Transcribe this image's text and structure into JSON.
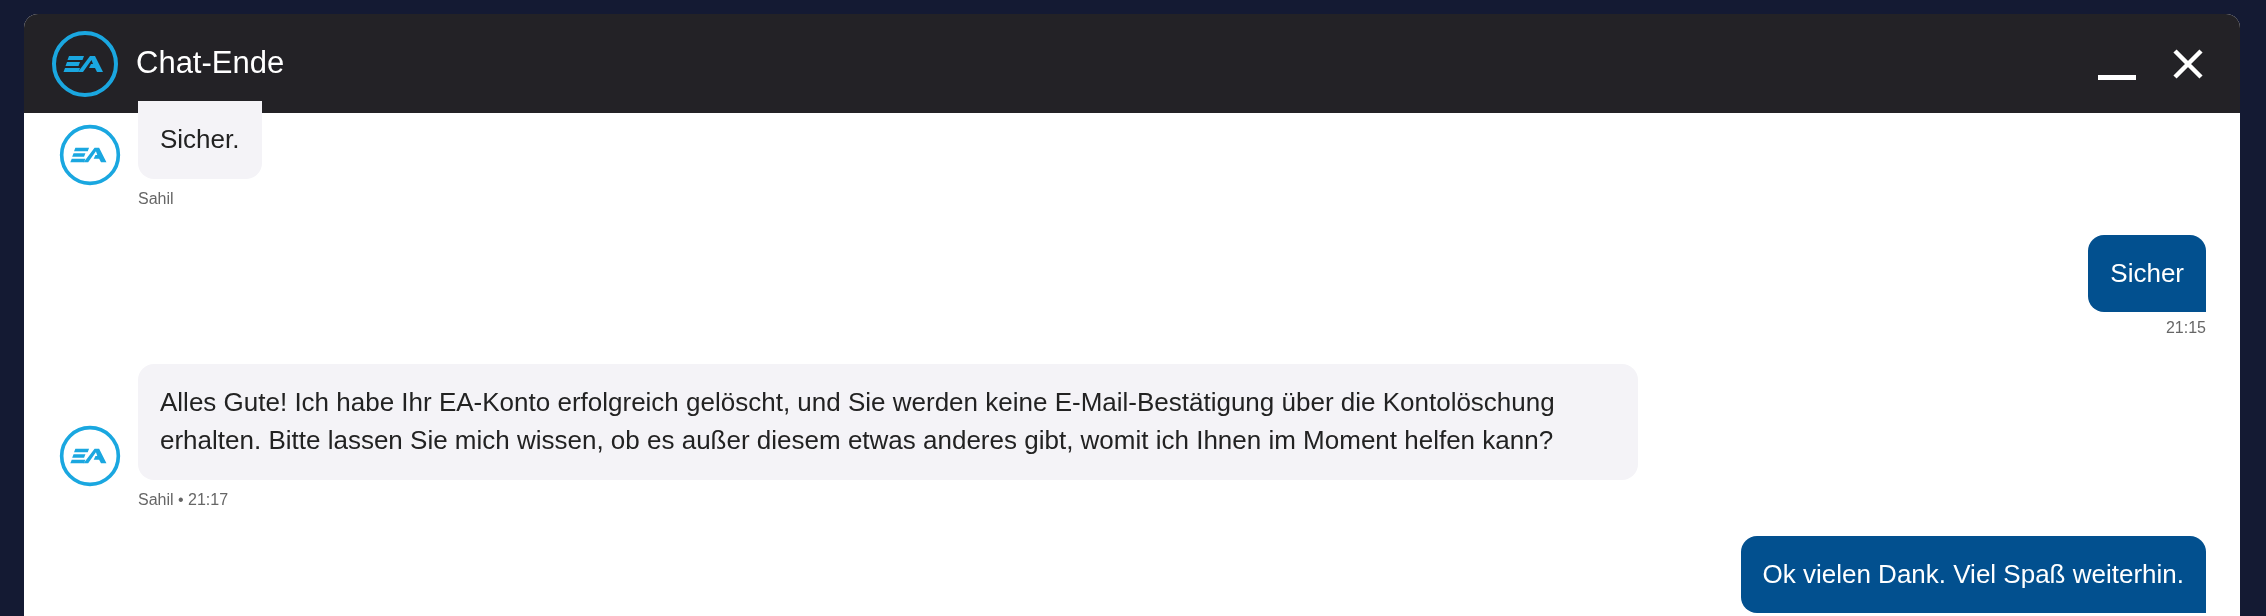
{
  "window": {
    "title": "Chat-Ende",
    "controls": [
      {
        "kind": "minimize"
      },
      {
        "kind": "close"
      }
    ]
  },
  "messages": [
    {
      "kind": "agent",
      "text": "Sicher.",
      "meta": "Sahil"
    },
    {
      "kind": "user",
      "text": "Sicher",
      "meta": "21:15"
    },
    {
      "kind": "agent",
      "text": "Alles Gute! Ich habe Ihr EA-Konto erfolgreich gelöscht, und Sie werden keine E-Mail-Bestätigung über die Kontolöschung erhalten. Bitte lassen Sie mich wissen, ob es außer diesem etwas anderes gibt, womit ich Ihnen im Moment helfen kann?",
      "meta": "Sahil • 21:17"
    },
    {
      "kind": "user",
      "text": "Ok vielen Dank. Viel Spaß weiterhin."
    }
  ]
}
